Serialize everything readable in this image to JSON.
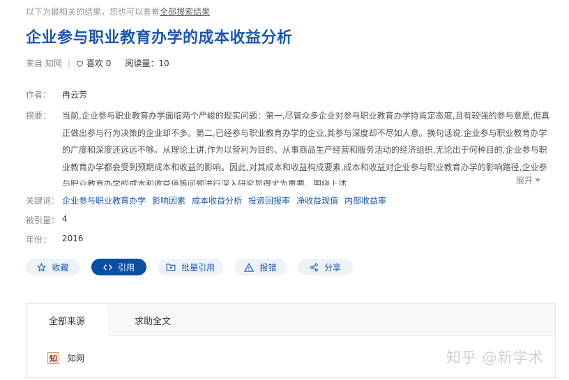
{
  "hint": {
    "prefix": "以下为最相关的结果，您也可以查看",
    "link": "全部搜索结果"
  },
  "title": "企业参与职业教育办学的成本收益分析",
  "meta": {
    "source": "来自 知网",
    "separator": "|",
    "like_label": "喜欢 0",
    "reads_label": "阅读量：",
    "reads_value": "10"
  },
  "author": {
    "label": "作者：",
    "value": "冉云芳"
  },
  "abstract": {
    "label": "摘要：",
    "text": "当前,企业参与职业教育办学面临两个严峻的现实问题：第一,尽管众多企业对参与职业教育办学持肯定态度,且有较强的参与意愿,但真正做出参与行为决策的企业却不多。第二,已经参与职业教育办学的企业,其参与深度却不尽如人意。换句话说,企业参与职业教育办学的广度和深度还远远不够。从理论上讲,作为以营利为目的、从事商品生产经营和服务活动的经济组织,无论出于何种目的,企业参与职业教育办学都会受到预期成本和收益的影响。因此,对其成本和收益构成要素,成本和收益对企业参与职业教育办学的影响路径,企业参与职业教育办学的成本和收益值等问题进行深入研究显得尤为重要。围绕上述",
    "expand_label": "展开"
  },
  "keywords": {
    "label": "关键词：",
    "items": [
      "企业参与职业教育办学",
      "影响因素",
      "成本收益分析",
      "投资回报率",
      "净收益现值",
      "内部收益率"
    ]
  },
  "cited": {
    "label": "被引量：",
    "value": "4"
  },
  "year": {
    "label": "年份：",
    "value": "2016"
  },
  "actions": {
    "collect": "收藏",
    "cite": "引用",
    "batch_cite": "批量引用",
    "report": "报错",
    "share": "分享"
  },
  "panel": {
    "tabs": [
      "全部来源",
      "求助全文"
    ],
    "source_logo": "知",
    "source_name": "知网"
  },
  "watermark": "知乎 @新学术",
  "colors": {
    "accent": "#1a56b4",
    "primary_button": "#0a4fa3",
    "button_bg": "#eef3fa"
  }
}
